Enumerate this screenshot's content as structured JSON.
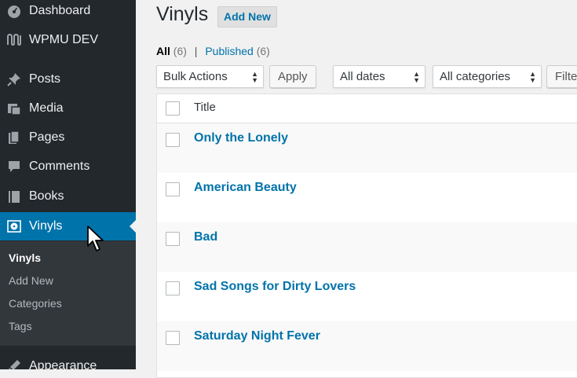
{
  "sidebar": {
    "items": [
      {
        "label": "Dashboard",
        "icon": "dashboard-icon"
      },
      {
        "label": "WPMU DEV",
        "icon": "wpmudev-icon"
      },
      {
        "label": "Posts",
        "icon": "pushpin-icon"
      },
      {
        "label": "Media",
        "icon": "media-icon"
      },
      {
        "label": "Pages",
        "icon": "pages-icon"
      },
      {
        "label": "Comments",
        "icon": "comments-icon"
      },
      {
        "label": "Books",
        "icon": "book-icon"
      },
      {
        "label": "Vinyls",
        "icon": "vinyl-icon"
      },
      {
        "label": "Appearance",
        "icon": "appearance-icon"
      }
    ],
    "submenu": [
      "Vinyls",
      "Add New",
      "Categories",
      "Tags"
    ]
  },
  "header": {
    "title": "Vinyls",
    "add_new": "Add New"
  },
  "filters": {
    "all_label": "All",
    "all_count": "(6)",
    "separator": "|",
    "published_label": "Published",
    "published_count": "(6)"
  },
  "toolbar": {
    "bulk_actions": "Bulk Actions",
    "apply": "Apply",
    "dates": "All dates",
    "categories": "All categories",
    "filter": "Filter"
  },
  "table": {
    "header_title": "Title",
    "rows": [
      "Only the Lonely",
      "American Beauty",
      "Bad",
      "Sad Songs for Dirty Lovers",
      "Saturday Night Fever"
    ]
  },
  "colors": {
    "sidebar_bg": "#23282d",
    "submenu_bg": "#32373c",
    "accent": "#0073aa",
    "link": "#0073aa"
  }
}
